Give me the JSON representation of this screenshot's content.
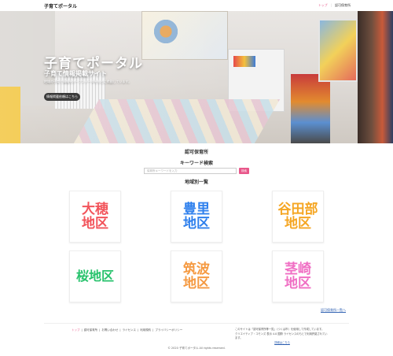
{
  "header": {
    "logo": "子育てポータル",
    "nav": [
      {
        "label": "トップ",
        "active": true
      },
      {
        "label": "認可保育所",
        "active": false
      }
    ]
  },
  "hero": {
    "title": "子育てポータル",
    "subtitle": "子育て情報掲載サイト",
    "description": "地域の子育て情報をオープンデータをもとに掲載しています。",
    "button_label": "情報掲載依頼はこちら"
  },
  "main": {
    "section_title": "認可保育所",
    "keyword_title": "キーワード検索",
    "search_placeholder": "保育所キーワードを入力",
    "search_button": "検索",
    "region_title": "地域別一覧",
    "regions": [
      {
        "label": "大穂\n地区",
        "color": "#f2545b"
      },
      {
        "label": "豊里\n地区",
        "color": "#2f80ed"
      },
      {
        "label": "谷田部\n地区",
        "color": "#f5a623"
      },
      {
        "label": "桜地区",
        "color": "#27c26c"
      },
      {
        "label": "筑波\n地区",
        "color": "#f59a42"
      },
      {
        "label": "茎崎\n地区",
        "color": "#f06fc4"
      }
    ],
    "more_link": "認可保育所一覧へ"
  },
  "footer": {
    "links": [
      "トップ",
      "認可保育所",
      "お問い合わせ",
      "ライセンス",
      "利用規約",
      "プライバシーポリシー"
    ],
    "info_line1": "このサイトは「認可保育所等一覧」（つくば市）を使用して作成しています。",
    "info_line2": "クリエイティブ・コモンズ 表示 4.0 国際 ライセンスのもとで利用許諾されています。",
    "info_link": "詳細はこちら",
    "copyright": "© 2020 子育てポータル All rights reserved."
  },
  "colors": {
    "accent": "#e8578a",
    "link": "#2a5db0"
  }
}
